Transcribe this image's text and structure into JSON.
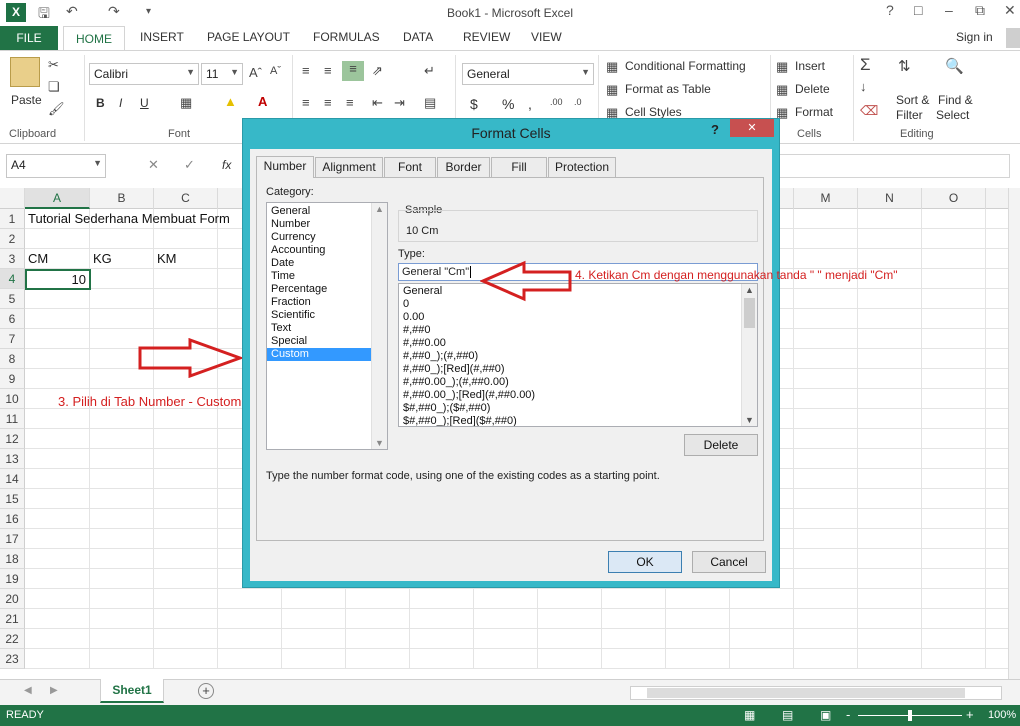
{
  "window": {
    "title": "Book1 - Microsoft Excel",
    "help": "?",
    "restore": "⧉",
    "minimize": "–",
    "close": "✕"
  },
  "ribbon_tabs": [
    "FILE",
    "HOME",
    "INSERT",
    "PAGE LAYOUT",
    "FORMULAS",
    "DATA",
    "REVIEW",
    "VIEW"
  ],
  "sign_in": "Sign in",
  "clipboard": {
    "paste": "Paste",
    "label": "Clipboard"
  },
  "font": {
    "name": "Calibri",
    "size": "11",
    "label": "Font",
    "bold": "B",
    "italic": "I",
    "underline": "U"
  },
  "number": {
    "format": "General",
    "currency": "$",
    "percent": "%",
    "comma": ","
  },
  "styles": {
    "conditional": "Conditional Formatting",
    "table": "Format as Table",
    "cell_styles": "Cell Styles"
  },
  "cells": {
    "insert": "Insert",
    "delete": "Delete",
    "format": "Format",
    "label": "Cells"
  },
  "editing": {
    "sort": "Sort &",
    "filter": "Filter",
    "find": "Find &",
    "select": "Select",
    "label": "Editing"
  },
  "formula_bar": {
    "name_box": "A4",
    "fx": "fx"
  },
  "columns": [
    "A",
    "B",
    "C",
    "M",
    "N",
    "O"
  ],
  "rows": [
    "1",
    "2",
    "3",
    "4",
    "5",
    "6",
    "7",
    "8",
    "9",
    "10",
    "11",
    "12",
    "13",
    "14",
    "15",
    "16",
    "17",
    "18",
    "19",
    "20",
    "21",
    "22",
    "23"
  ],
  "cells_data": {
    "a1": "Tutorial Sederhana Membuat Form",
    "a3": "CM",
    "b3": "KG",
    "c3": "KM",
    "a4": "10"
  },
  "annotations": {
    "step3": "3. Pilih di Tab Number - Custom - General",
    "step4": "4. Ketikan Cm dengan menggunakan tanda \" \" menjadi \"Cm\""
  },
  "sheet": {
    "tab": "Sheet1",
    "add": "+"
  },
  "status": {
    "ready": "READY",
    "zoom": "100%",
    "minus": "-",
    "plus": "+"
  },
  "dialog": {
    "title": "Format Cells",
    "help": "?",
    "close": "✕",
    "tabs": [
      "Number",
      "Alignment",
      "Font",
      "Border",
      "Fill",
      "Protection"
    ],
    "category_label": "Category:",
    "categories": [
      "General",
      "Number",
      "Currency",
      "Accounting",
      "Date",
      "Time",
      "Percentage",
      "Fraction",
      "Scientific",
      "Text",
      "Special",
      "Custom"
    ],
    "selected_category": "Custom",
    "sample_label": "Sample",
    "sample_value": "10 Cm",
    "type_label": "Type:",
    "type_value": "General \"Cm\"",
    "formats": [
      "General",
      "0",
      "0.00",
      "#,##0",
      "#,##0.00",
      "#,##0_);(#,##0)",
      "#,##0_);[Red](#,##0)",
      "#,##0.00_);(#,##0.00)",
      "#,##0.00_);[Red](#,##0.00)",
      "$#,##0_);($#,##0)",
      "$#,##0_);[Red]($#,##0)"
    ],
    "delete": "Delete",
    "hint": "Type the number format code, using one of the existing codes as a starting point.",
    "ok": "OK",
    "cancel": "Cancel"
  },
  "colors": {
    "excel_green": "#217346",
    "dialog_frame": "#37b8c8",
    "close_red": "#c75050",
    "selection": "#3399ff",
    "annotation": "#d42020"
  }
}
